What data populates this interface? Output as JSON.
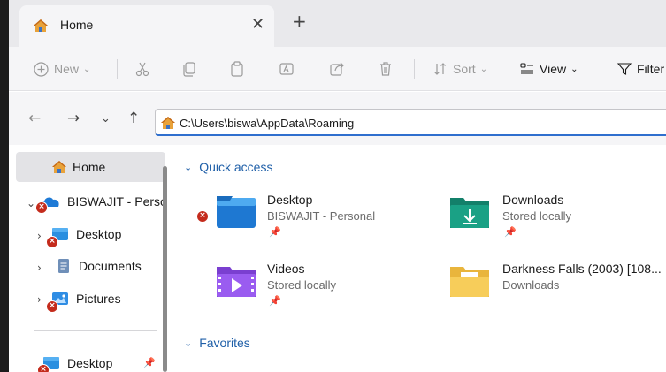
{
  "tab": {
    "title": "Home",
    "close": "✕",
    "new": "+"
  },
  "toolbar": {
    "new_label": "New",
    "sort_label": "Sort",
    "view_label": "View",
    "filter_label": "Filter"
  },
  "address": {
    "path": "C:\\Users\\biswa\\AppData\\Roaming"
  },
  "sidebar": {
    "home_label": "Home",
    "items": [
      {
        "label": "BISWAJIT - Perso",
        "icon": "onedrive-icon"
      },
      {
        "label": "Desktop",
        "icon": "desktop-folder-icon"
      },
      {
        "label": "Documents",
        "icon": "documents-icon"
      },
      {
        "label": "Pictures",
        "icon": "pictures-icon"
      }
    ],
    "pinned": [
      {
        "label": "Desktop",
        "icon": "desktop-folder-icon"
      }
    ]
  },
  "main": {
    "quick_access_label": "Quick access",
    "favorites_label": "Favorites",
    "cards": [
      {
        "title": "Desktop",
        "subtitle": "BISWAJIT - Personal",
        "icon": "desktop-folder-icon"
      },
      {
        "title": "Downloads",
        "subtitle": "Stored locally",
        "icon": "downloads-folder-icon"
      },
      {
        "title": "Videos",
        "subtitle": "Stored locally",
        "icon": "videos-folder-icon"
      },
      {
        "title": "Darkness Falls (2003) [108...",
        "subtitle": "Downloads",
        "icon": "folder-icon"
      }
    ]
  },
  "colors": {
    "accent": "#2f6fce",
    "link": "#1f5fa8",
    "error": "#c42b1c"
  }
}
